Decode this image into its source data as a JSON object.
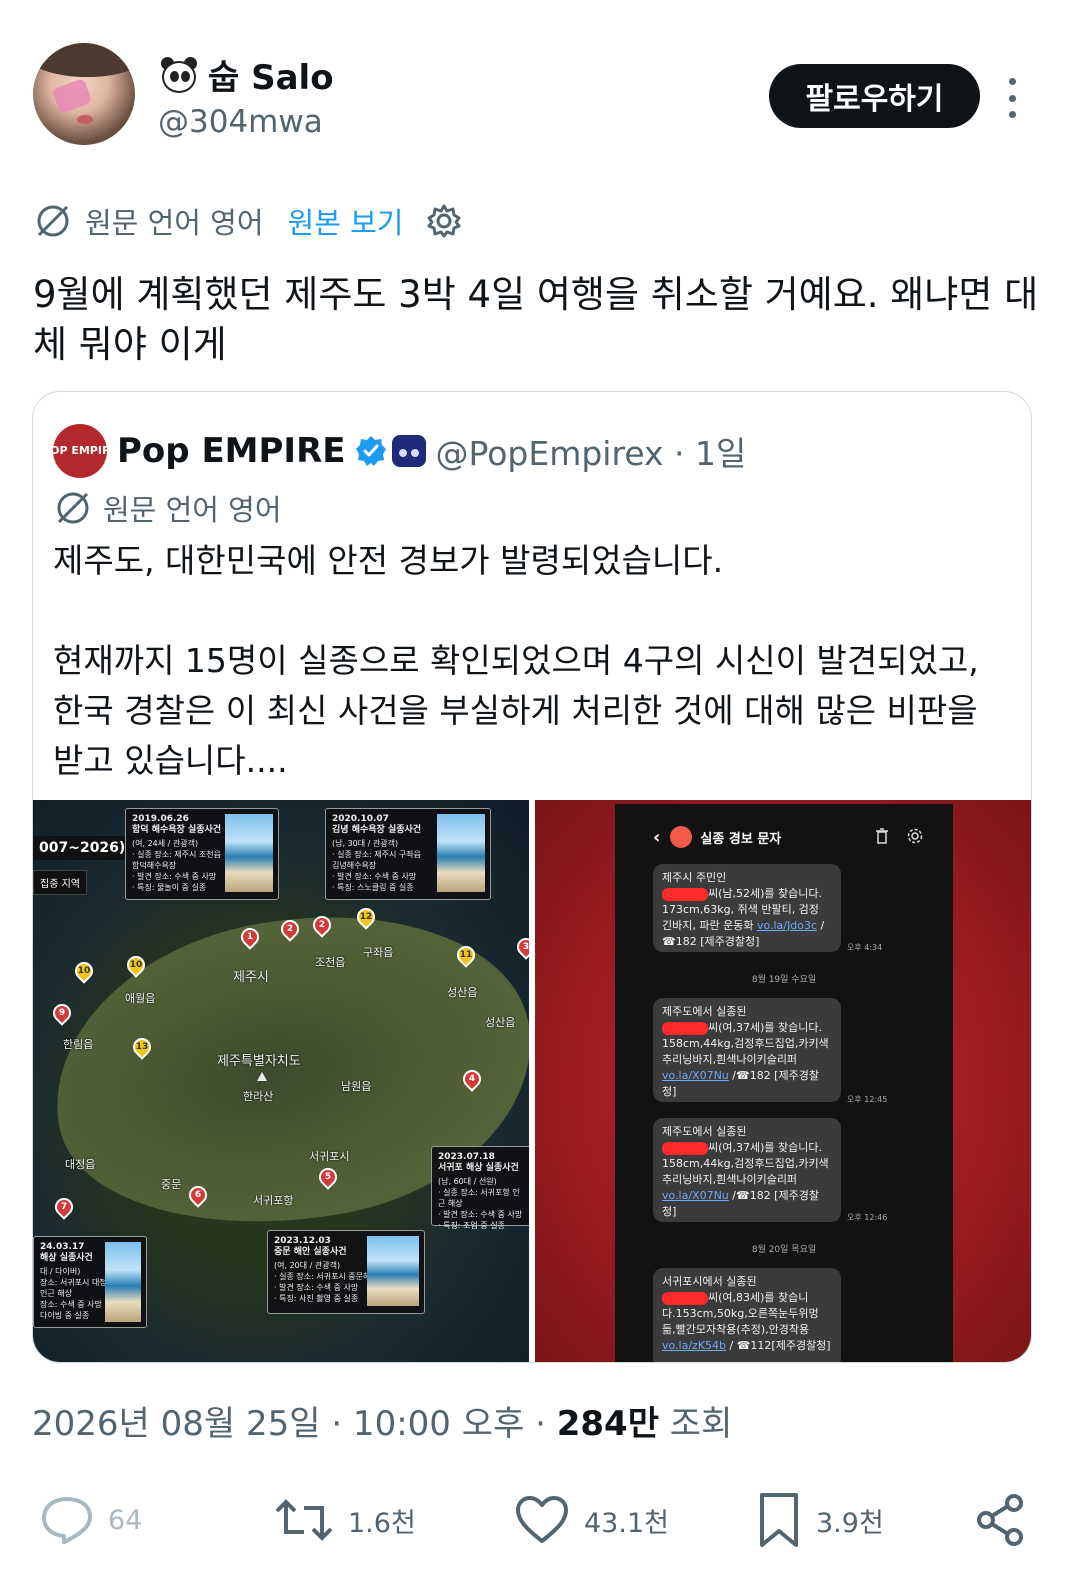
{
  "author": {
    "name_emoji": "panda",
    "name": "숩 Salo",
    "handle": "@304mwa"
  },
  "follow_label": "팔로우하기",
  "translation": {
    "label": "원문 언어 영어",
    "show_original": "원본 보기"
  },
  "tweet_text": "9월에 계획했던 제주도 3박 4일 여행을 취소할 거예요. 왜냐면 대체 뭐야 이게",
  "quote": {
    "logo_text": "POP EMPIRE",
    "name": "Pop EMPIRE",
    "handle_time": "@PopEmpirex · 1일",
    "translation_label": "원문 언어 영어",
    "text": "제주도, 대한민국에 안전 경보가 발령되었습니다.\n\n현재까지 15명이 실종으로 확인되었으며 4구의 시신이 발견되었고, 한국 경찰은 이 최신 사건을 부실하게 처리한 것에 대해 많은 비판을 받고 있습니다....",
    "map": {
      "title": "007~2026)",
      "subtitle": "\u001f 집중 지역",
      "labels": {
        "jeju_city": "제주시",
        "jocheon": "조천읍",
        "gujwa": "구좌읍",
        "aewol": "애월읍",
        "hallim": "한림읍",
        "seongsan": "성산읍",
        "seongsan2": "성산읍",
        "special": "제주특별자치도",
        "hallasan": "한라산",
        "namwon": "남원읍",
        "seogwipo": "서귀포시",
        "seogwipo_port": "서귀포항",
        "jungmun": "중문",
        "daejeong": "대정읍"
      },
      "cards": {
        "c1": {
          "date": "2019.06.26",
          "title": "함덕 해수욕장 실종사건",
          "lines": [
            "(여, 24세 / 관광객)",
            "· 실종 장소: 제주시 조천읍",
            "  함덕해수욕장",
            "· 발견 장소: 수색 중 사망",
            "· 특징: 물놀이 중 실종"
          ]
        },
        "c2": {
          "date": "2020.10.07",
          "title": "김녕 해수욕장 실종사건",
          "lines": [
            "(남, 30대 / 관광객)",
            "· 실종 장소: 제주시 구좌읍",
            "  김녕해수욕장",
            "· 발견 장소: 수색 중 사망",
            "· 특징: 스노클링 중 실종"
          ]
        },
        "c5": {
          "date": "2023.07.18",
          "title": "서귀포 해상 실종사건",
          "lines": [
            "(남, 60대 / 선원)",
            "· 실종 장소: 서귀포항 인근 해상",
            "· 발견 장소: 수색 중 사망",
            "· 특징: 조업 중 실종"
          ]
        },
        "c6": {
          "date": "2023.12.03",
          "title": "중문 해안 실종사건",
          "lines": [
            "(여, 20대 / 관광객)",
            "· 실종 장소: 서귀포시 중문해변 인근",
            "· 발견 장소: 수색 중 사망",
            "· 특징: 사진 촬영 중 실종"
          ]
        },
        "c7": {
          "date": "24.03.17",
          "title": "해상 실종사건",
          "lines": [
            "대 / 다이버)",
            "장소: 서귀포시 대정읍",
            "인근 해상",
            "장소: 수색 중 사망",
            "다이빙 중 실종"
          ]
        }
      }
    },
    "sms": {
      "title": "실종 경보 문자",
      "messages": [
        {
          "pre": "제주시 주민인",
          "body": "씨(남,52세)를 찾습니다. 173cm,63kg, 쥐색 반팔티, 검정 긴바지, 파란 운동화",
          "link": "vo.la/Jdo3c",
          "tail": "/ ☎182 [제주경찰청]",
          "time": "오후 4:34"
        },
        {
          "pre": "제주도에서 실종된",
          "body": "씨(여,37세)를 찾습니다. 158cm,44kg,검정후드집업,카키색추리닝바지,흰색나이키슬리퍼",
          "link": "vo.la/X07Nu",
          "tail": "/☎182 [제주경찰청]",
          "time": "오후 12:45"
        },
        {
          "pre": "제주도에서 실종된",
          "body": "씨(여,37세)를 찾습니다. 158cm,44kg,검정후드집업,카키색추리닝바지,흰색나이키슬리퍼",
          "link": "vo.la/X07Nu",
          "tail": "/☎182 [제주경찰청]",
          "time": "오후 12:46"
        },
        {
          "pre": "서귀포시에서 실종된",
          "body": "씨(여,83세)를 찾습니다.153cm,50kg,오른쪽눈두위멍듦,빨간모자착용(추정),안경착용",
          "link": "vo.la/zK54b",
          "tail": "/ ☎112[제주경찰청]",
          "time": ""
        }
      ],
      "dates": [
        "8월 19일 수요일",
        "8월 20일 목요일"
      ]
    }
  },
  "meta": {
    "datetime": "2026년 08월 25일 · 10:00 오후 · ",
    "views_count": "284만",
    "views_label": " 조회"
  },
  "actions": {
    "replies": "64",
    "reposts": "1.6천",
    "likes": "43.1천",
    "bookmarks": "3.9천"
  },
  "colors": {
    "accent_link": "#1d9bf0",
    "text_primary": "#0f1419",
    "text_secondary": "#536471",
    "border": "#cfd9de",
    "verified": "#1d9bf0"
  }
}
